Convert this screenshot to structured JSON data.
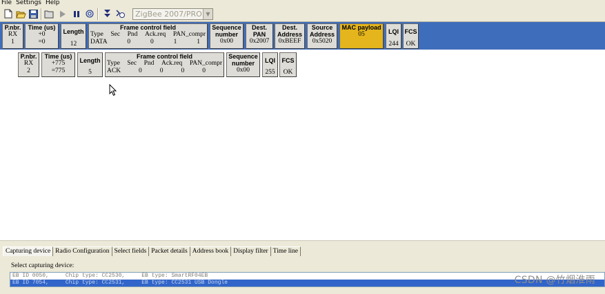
{
  "menu": [
    "File",
    "Settings",
    "Help"
  ],
  "toolbar": {
    "icons": [
      "new-file-icon",
      "open-folder-icon",
      "save-icon",
      "open-icon",
      "play-icon",
      "pause-icon",
      "settings-icon",
      "scroll-down-icon",
      "scroll-toggle-icon"
    ],
    "protocol_select": "ZigBee 2007/PRO"
  },
  "packets": [
    {
      "pnbr_hdr": "P.nbr.",
      "direction": "RX",
      "number": "1",
      "time_hdr": "Time (us)",
      "time_delta": "+0",
      "time_abs": "=0",
      "length_hdr": "Length",
      "length": "12",
      "fcf_hdr": "Frame control field",
      "fcf_cols": [
        "Type",
        "Sec",
        "Pnd",
        "Ack.req",
        "PAN_compr"
      ],
      "fcf_vals": [
        "DATA",
        "0",
        "0",
        "1",
        "1"
      ],
      "seq_hdr_1": "Sequence",
      "seq_hdr_2": "number",
      "seq": "0x00",
      "dpan_hdr_1": "Dest.",
      "dpan_hdr_2": "PAN",
      "dpan": "0x2007",
      "daddr_hdr_1": "Dest.",
      "daddr_hdr_2": "Address",
      "daddr": "0xBEEF",
      "saddr_hdr_1": "Source",
      "saddr_hdr_2": "Address",
      "saddr": "0x5020",
      "mac_hdr": "MAC payload",
      "mac": "05",
      "lqi_hdr": "LQI",
      "lqi": "244",
      "fcs_hdr": "FCS",
      "fcs": "OK"
    },
    {
      "pnbr_hdr": "P.nbr.",
      "direction": "RX",
      "number": "2",
      "time_hdr": "Time (us)",
      "time_delta": "+775",
      "time_abs": "=775",
      "length_hdr": "Length",
      "length": "5",
      "fcf_hdr": "Frame control field",
      "fcf_cols": [
        "Type",
        "Sec",
        "Pnd",
        "Ack.req",
        "PAN_compr"
      ],
      "fcf_vals": [
        "ACK",
        "0",
        "0",
        "0",
        "0"
      ],
      "seq_hdr_1": "Sequence",
      "seq_hdr_2": "number",
      "seq": "0x00",
      "lqi_hdr": "LQI",
      "lqi": "255",
      "fcs_hdr": "FCS",
      "fcs": "OK"
    }
  ],
  "tabs": [
    "Capturing device",
    "Radio Configuration",
    "Select fields",
    "Packet details",
    "Address book",
    "Display filter",
    "Time line"
  ],
  "select_label": "Select capturing device:",
  "devices": [
    "EB ID 0050,     Chip type: CC2530,     EB type: SmartRF04EB",
    "EB ID 7054,     Chip type: CC2531,     EB type: CC2531 USB Dongle"
  ],
  "watermark": "CSDN @竹烟淮雨",
  "colors": {
    "packet_band": "#3e6dbb",
    "mac_payload": "#e4b51c",
    "cell_bg": "#dddcd6",
    "selected_row": "#3165c9"
  }
}
